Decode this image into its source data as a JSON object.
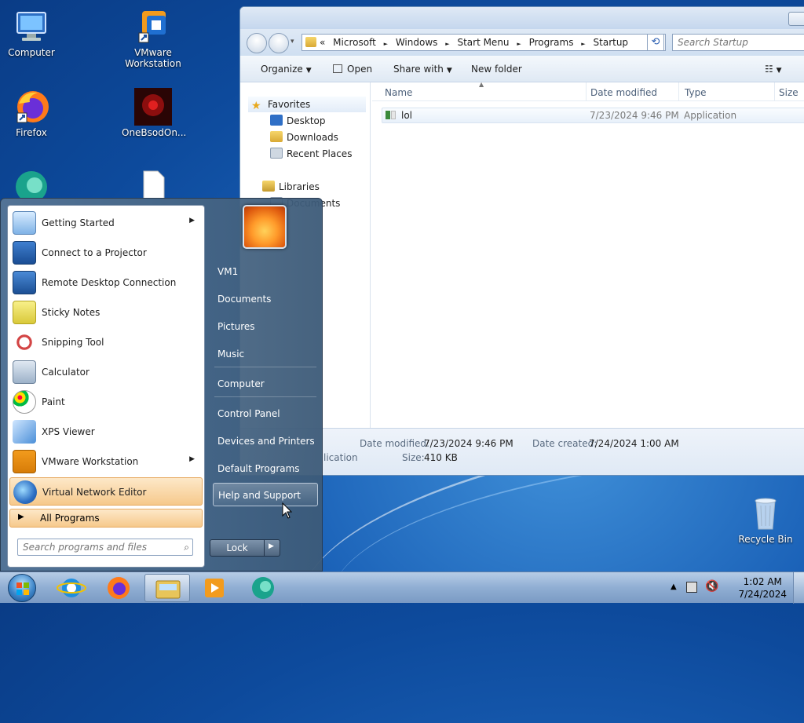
{
  "desktop": {
    "icons": [
      {
        "label": "Computer"
      },
      {
        "label": "VMware Workstation"
      },
      {
        "label": "Firefox"
      },
      {
        "label": "OneBsodOn..."
      },
      {
        "label": "Recycle Bin"
      }
    ]
  },
  "explorer": {
    "address": {
      "prefix": "«",
      "crumbs": [
        "Microsoft",
        "Windows",
        "Start Menu",
        "Programs",
        "Startup"
      ],
      "separator": "►"
    },
    "search_placeholder": "Search Startup",
    "toolbar": {
      "organize": "Organize",
      "open": "Open",
      "share_with": "Share with",
      "new_folder": "New folder"
    },
    "nav": {
      "favorites": "Favorites",
      "desktop": "Desktop",
      "downloads": "Downloads",
      "recent_places": "Recent Places",
      "libraries": "Libraries",
      "documents": "Documents"
    },
    "columns": {
      "name": "Name",
      "date_modified": "Date modified",
      "type": "Type",
      "size": "Size"
    },
    "files": [
      {
        "name": "lol",
        "date_modified": "7/23/2024 9:46 PM",
        "type": "Application"
      }
    ],
    "details": {
      "date_modified_label": "Date modified:",
      "date_modified_value": "7/23/2024 9:46 PM",
      "date_created_label": "Date created:",
      "date_created_value": "7/24/2024 1:00 AM",
      "type_partial": "lication",
      "size_label": "Size:",
      "size_value": "410 KB"
    }
  },
  "start_menu": {
    "programs": [
      {
        "label": "Getting Started",
        "submenu": true
      },
      {
        "label": "Connect to a Projector",
        "submenu": false
      },
      {
        "label": "Remote Desktop Connection",
        "submenu": false
      },
      {
        "label": "Sticky Notes",
        "submenu": false
      },
      {
        "label": "Snipping Tool",
        "submenu": false
      },
      {
        "label": "Calculator",
        "submenu": false
      },
      {
        "label": "Paint",
        "submenu": false
      },
      {
        "label": "XPS Viewer",
        "submenu": false
      },
      {
        "label": "VMware Workstation",
        "submenu": true
      },
      {
        "label": "Virtual Network Editor",
        "submenu": false
      }
    ],
    "all_programs": "All Programs",
    "search_placeholder": "Search programs and files",
    "right_links": [
      "VM1",
      "Documents",
      "Pictures",
      "Music",
      "Computer",
      "Control Panel",
      "Devices and Printers",
      "Default Programs",
      "Help and Support"
    ],
    "lock_label": "Lock"
  },
  "taskbar": {
    "clock_time": "1:02 AM",
    "clock_date": "7/24/2024"
  },
  "colors": {
    "desktop_blue": "#1b62b8",
    "highlight_orange": "#f6c98c",
    "taskbar_blue": "#90aed3"
  }
}
